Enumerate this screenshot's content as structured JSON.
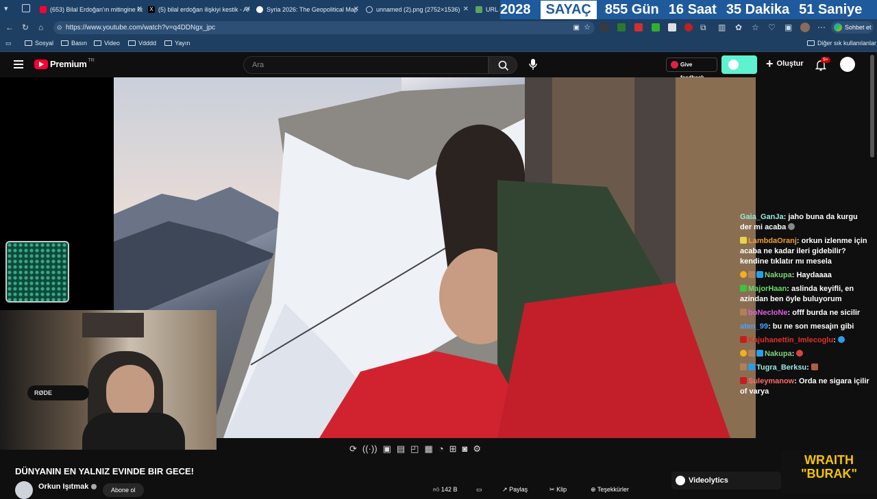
{
  "browser": {
    "tabs": [
      {
        "title": "(653) Bilal Erdoğan'ın mitingine ka",
        "fav_color": "#ff0033"
      },
      {
        "title": "(5) bilal erdoğan ilişkiyi kestik - Ar",
        "fav_color": "#000000"
      },
      {
        "title": "Syria 2026: The Geopolitical Map o",
        "fav_color": "#ffffff"
      },
      {
        "title": "unnamed (2).png (2752×1536)",
        "fav_color": "#cfd8e3"
      },
      {
        "title": "URL N",
        "fav_color": "#5aa65a"
      }
    ],
    "url": "https://www.youtube.com/watch?v=q4DDNgx_jpc",
    "copilot_label": "Sohbet et",
    "bookmarks": [
      "Sosyal",
      "Basın",
      "Video",
      "Vdddd",
      "Yayın"
    ],
    "other_bookmarks": "Diğer sık kullanılanlar"
  },
  "countdown": {
    "year": "2028",
    "label": "SAYAÇ",
    "days": "855 Gün",
    "hours": "16 Saat",
    "minutes": "35 Dakika",
    "seconds": "51 Saniye"
  },
  "youtube": {
    "logo": "Premium",
    "region": "TR",
    "search_placeholder": "Ara",
    "feedback": "Give feedback",
    "create": "Oluştur",
    "notif_count": "9+",
    "video_title": "DÜNYANIN EN YALNIZ EVINDE BIR GECE!",
    "channel": "Orkun Işıtmak",
    "subscribe": "Abone ol",
    "likes": "142 B",
    "share": "Paylaş",
    "clip": "Klip",
    "thanks": "Teşekkürler",
    "videolytics": "Videolytics"
  },
  "stream_overlay": {
    "brand": "WRAITH",
    "brand2": "\"BURAK\""
  },
  "chat": [
    {
      "user": "Gaia_GanJa",
      "color": "#9be8e0",
      "text": "jaho buna da kurgu der mi acaba"
    },
    {
      "user": "LambdaOranj",
      "color": "#f0a030",
      "text": "orkun izlenme için acaba ne kadar ileri gidebilir? kendine tıklatır mı mesela"
    },
    {
      "user": "Nakupa",
      "color": "#7bd37b",
      "text": "Haydaaaa"
    },
    {
      "user": "MajorHaan",
      "color": "#66dd66",
      "text": "aslinda keyifli, en azindan ben öyle buluyorum"
    },
    {
      "user": "boNecIoNe",
      "color": "#e05ee0",
      "text": "offf burda ne sicilir"
    },
    {
      "user": "aten_99",
      "color": "#4aa0ff",
      "text": "bu ne son mesajın gibi"
    },
    {
      "user": "Kajuhanettin_Imlecoglu",
      "color": "#e03030",
      "text": ""
    },
    {
      "user": "Nakupa",
      "color": "#7bd37b",
      "text": ""
    },
    {
      "user": "Tugra_Berksu",
      "color": "#9be8e0",
      "text": ""
    },
    {
      "user": "Suleymanow",
      "color": "#ff6b6b",
      "text": "Orda ne sigara içilir of varya"
    }
  ]
}
